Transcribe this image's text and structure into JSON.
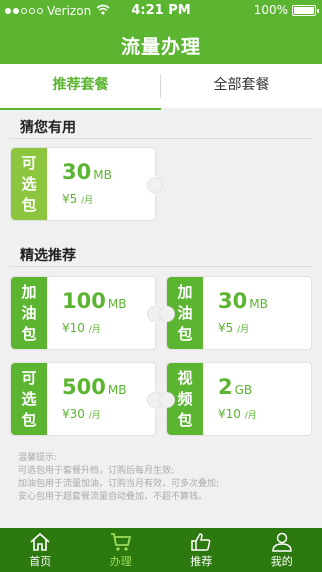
{
  "status_bar": {
    "carrier": "Verizon",
    "time": "4:21 PM",
    "battery": "100%",
    "signal_bars_filled": 2,
    "signal_bars_total": 5
  },
  "header": {
    "title": "流量办理"
  },
  "tabs": [
    {
      "label": "推荐套餐",
      "active": true
    },
    {
      "label": "全部套餐",
      "active": false
    }
  ],
  "guess": {
    "title": "猜您有用",
    "card": {
      "tag": [
        "可",
        "选",
        "包"
      ],
      "amount": "30",
      "unit": "MB",
      "price": "¥5",
      "per": "/月"
    }
  },
  "featured": {
    "title": "精选推荐",
    "cards": [
      {
        "tag": [
          "加",
          "油",
          "包"
        ],
        "amount": "100",
        "unit": "MB",
        "price": "¥10",
        "per": "/月"
      },
      {
        "tag": [
          "加",
          "油",
          "包"
        ],
        "amount": "30",
        "unit": "MB",
        "price": "¥5",
        "per": "/月"
      },
      {
        "tag": [
          "可",
          "选",
          "包"
        ],
        "amount": "500",
        "unit": "MB",
        "price": "¥30",
        "per": "/月"
      },
      {
        "tag": [
          "视",
          "频",
          "包"
        ],
        "amount": "2",
        "unit": "GB",
        "price": "¥10",
        "per": "/月"
      }
    ]
  },
  "tips": {
    "heading": "温馨提示:",
    "lines": [
      "可选包用于套餐升档，订购后每月生效;",
      "加油包用于流量加油，订购当月有效，可多次叠加;",
      "安心包用于超套餐流量自动叠加，不超不算钱。"
    ]
  },
  "tabbar": [
    {
      "label": "首页",
      "icon": "home-icon",
      "active": false
    },
    {
      "label": "办理",
      "icon": "cart-icon",
      "active": true
    },
    {
      "label": "推荐",
      "icon": "thumbs-up-icon",
      "active": false
    },
    {
      "label": "我的",
      "icon": "user-icon",
      "active": false
    }
  ],
  "colors": {
    "brand": "#5cb531",
    "tag_light": "#8cc63f",
    "tabbar": "#2c7a0f",
    "tabbar_active": "#9ddc5c"
  }
}
